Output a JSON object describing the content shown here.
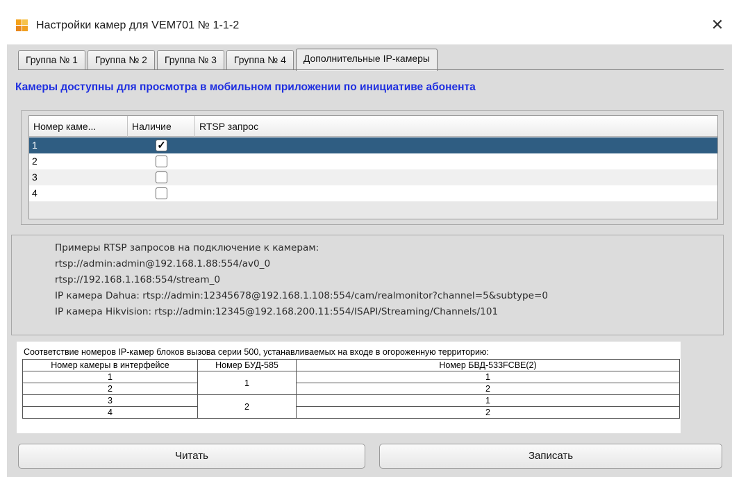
{
  "window": {
    "title": "Настройки камер для VEM701 № 1-1-2",
    "close_glyph": "✕"
  },
  "tabs": [
    {
      "label": "Группа № 1",
      "active": false
    },
    {
      "label": "Группа № 2",
      "active": false
    },
    {
      "label": "Группа № 3",
      "active": false
    },
    {
      "label": "Группа № 4",
      "active": false
    },
    {
      "label": "Дополнительные IP-камеры",
      "active": true
    }
  ],
  "section_title": "Камеры доступны для просмотра в мобильном приложении по инициативе абонента",
  "camera_table": {
    "headers": [
      "Номер каме...",
      "Наличие",
      "RTSP запрос"
    ],
    "rows": [
      {
        "number": "1",
        "present": true,
        "rtsp": "",
        "selected": true
      },
      {
        "number": "2",
        "present": false,
        "rtsp": "",
        "selected": false
      },
      {
        "number": "3",
        "present": false,
        "rtsp": "",
        "selected": false
      },
      {
        "number": "4",
        "present": false,
        "rtsp": "",
        "selected": false
      }
    ],
    "check_glyph": "✓"
  },
  "examples": {
    "lines": [
      "Примеры RTSP запросов на подключение к камерам:",
      "rtsp://admin:admin@192.168.1.88:554/av0_0",
      "rtsp://192.168.1.168:554/stream_0",
      "IP камера Dahua: rtsp://admin:12345678@192.168.1.108:554/cam/realmonitor?channel=5&subtype=0",
      "IP камера Hikvision: rtsp://admin:12345@192.168.200.11:554/ISAPI/Streaming/Channels/101"
    ]
  },
  "compat": {
    "caption": "Соответствие номеров IP-камер блоков вызова серии 500, устанавливаемых на входе в огороженную территорию:",
    "headers": [
      "Номер камеры в интерфейсе",
      "Номер БУД-585",
      "Номер БВД-533FCBE(2)"
    ],
    "rows": [
      [
        "1",
        "1",
        "1"
      ],
      [
        "2",
        "",
        "2"
      ],
      [
        "3",
        "2",
        "1"
      ],
      [
        "4",
        "",
        "2"
      ]
    ]
  },
  "buttons": {
    "read": "Читать",
    "write": "Записать"
  },
  "colors": {
    "section_title": "#1f2fe0",
    "selected_row": "#2f5d82",
    "client_bg": "#dcdcdc"
  }
}
